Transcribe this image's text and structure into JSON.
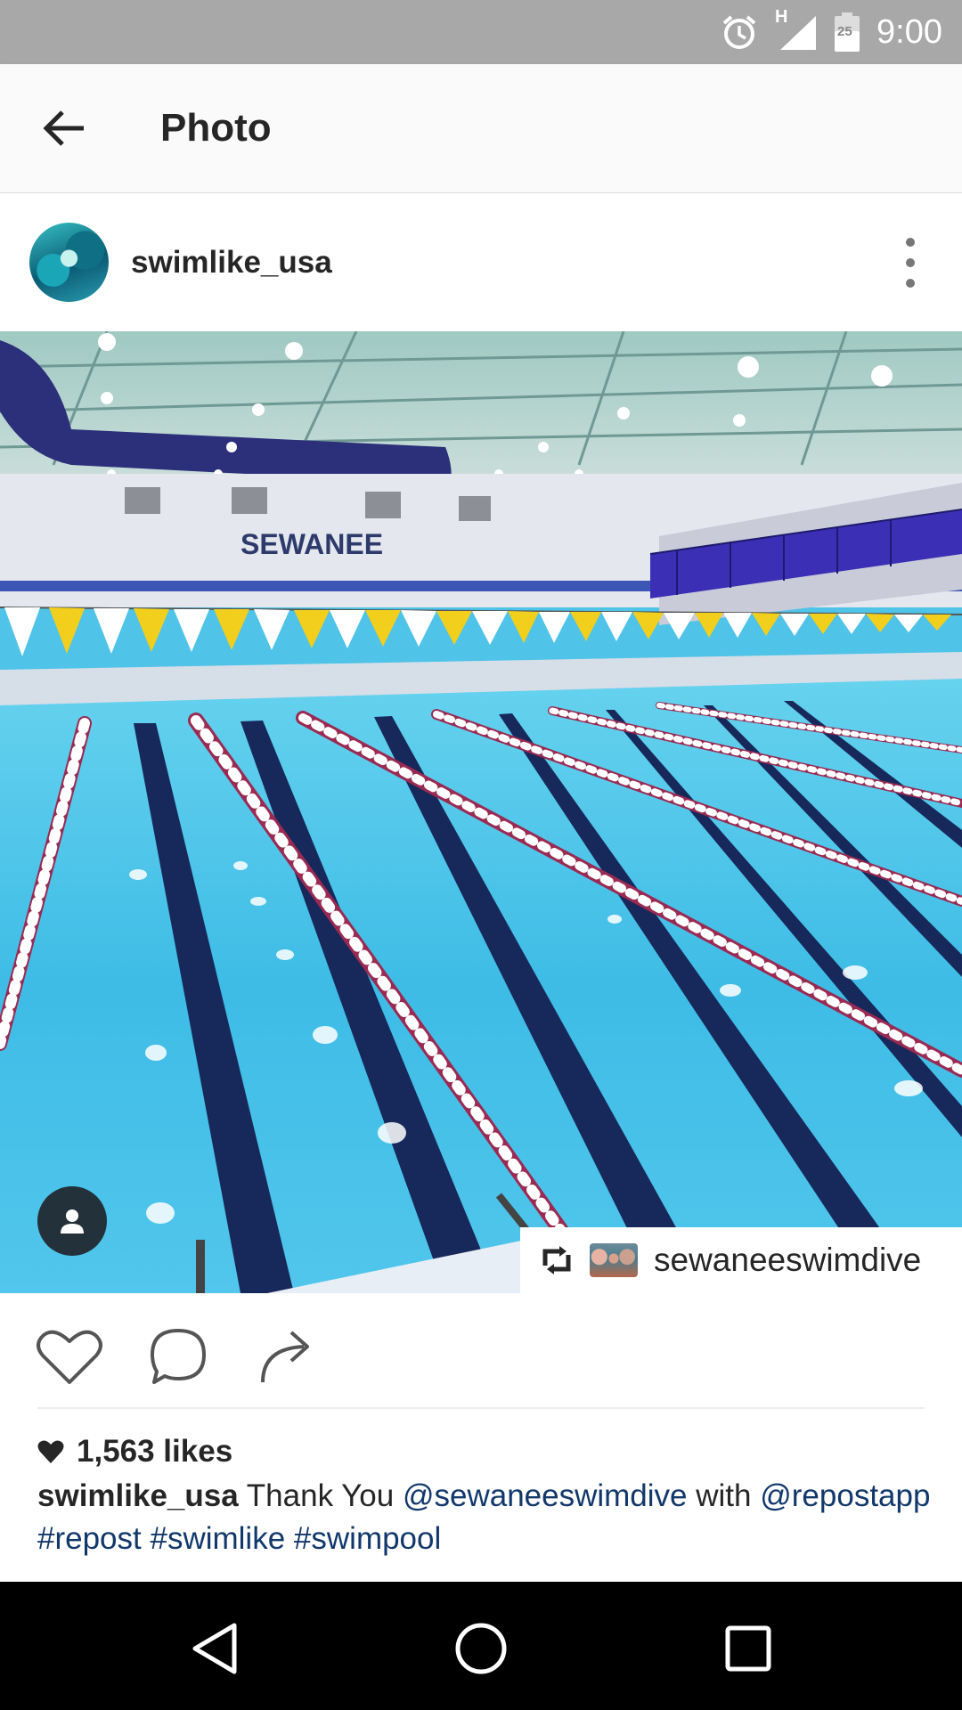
{
  "status_bar": {
    "time": "9:00",
    "network": "H",
    "battery_level": "25",
    "icons": [
      "alarm-icon",
      "signal-icon",
      "battery-icon"
    ]
  },
  "toolbar": {
    "title": "Photo",
    "back_icon": "arrow-back-icon"
  },
  "post": {
    "username": "swimlike_usa",
    "more_icon": "more-vertical-icon",
    "photo": {
      "sign_text": "SEWANEE",
      "repost_credit": "sewaneeswimdive",
      "tag_icon": "person-icon"
    },
    "actions": [
      "like-icon",
      "comment-icon",
      "share-icon"
    ],
    "likes_text": "1,563 likes",
    "caption": {
      "user": "swimlike_usa",
      "text1": "Thank You",
      "mention1": "@sewaneeswimdive",
      "text2": "with",
      "mention2": "@repostapp",
      "hashtag1": "#repost",
      "hashtag2": "#swimlike",
      "hashtag3": "#swimpool"
    }
  },
  "nav_bar": {
    "buttons": [
      "back-nav-icon",
      "home-nav-icon",
      "recents-nav-icon"
    ]
  },
  "colors": {
    "status_bar": "#a8a8a8",
    "link": "#12386b",
    "pool_water": "#4fc3e8"
  }
}
